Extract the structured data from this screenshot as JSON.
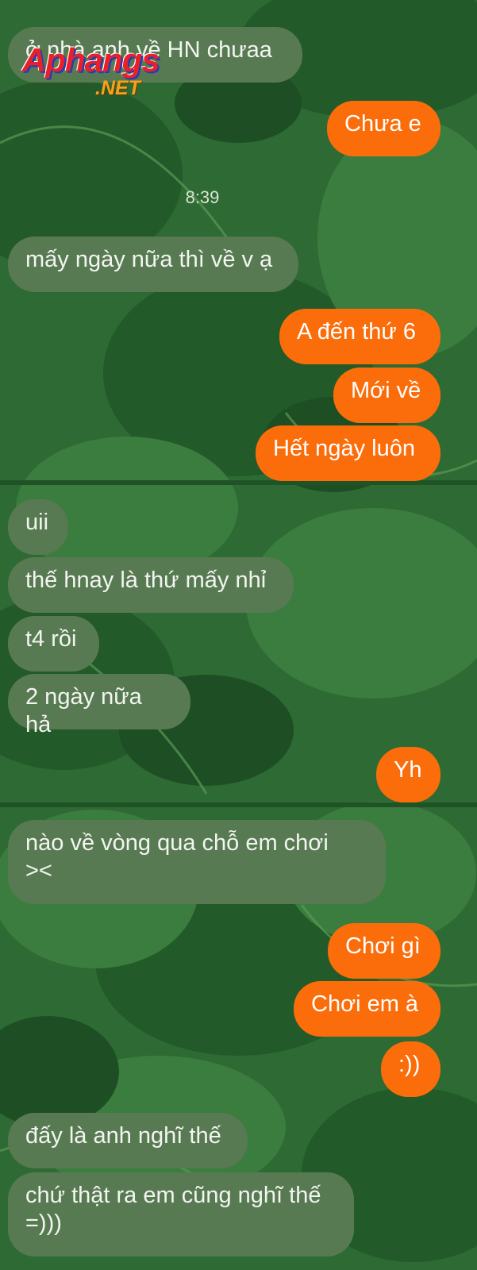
{
  "watermark": {
    "brand": "Aphangs",
    "suffix": ".NET"
  },
  "timestamp": "8:39",
  "colors": {
    "incoming_bubble": "#587a52",
    "outgoing_bubble": "#fb6d0b",
    "background": "#2e6a33"
  },
  "messages": [
    {
      "dir": "in",
      "text": "ở nhà anh về HN chưaa"
    },
    {
      "dir": "out",
      "text": "Chưa e"
    },
    {
      "dir": "in",
      "text": "mấy ngày nữa thì về v ạ"
    },
    {
      "dir": "out",
      "text": "A đến thứ 6"
    },
    {
      "dir": "out",
      "text": "Mới về"
    },
    {
      "dir": "out",
      "text": "Hết ngày luôn"
    },
    {
      "dir": "in",
      "text": "uii"
    },
    {
      "dir": "in",
      "text": "thế hnay là thứ mấy nhỉ"
    },
    {
      "dir": "in",
      "text": "t4 rồi"
    },
    {
      "dir": "in",
      "text": "2 ngày nữa hả"
    },
    {
      "dir": "out",
      "text": "Yh"
    },
    {
      "dir": "in",
      "text": "nào về vòng qua chỗ em chơi\n><"
    },
    {
      "dir": "out",
      "text": "Chơi gì"
    },
    {
      "dir": "out",
      "text": "Chơi em à"
    },
    {
      "dir": "out",
      "text": ":))"
    },
    {
      "dir": "in",
      "text": "đấy là anh nghĩ thế"
    },
    {
      "dir": "in",
      "text": "chứ thật ra em cũng nghĩ thế\n=)))"
    }
  ]
}
